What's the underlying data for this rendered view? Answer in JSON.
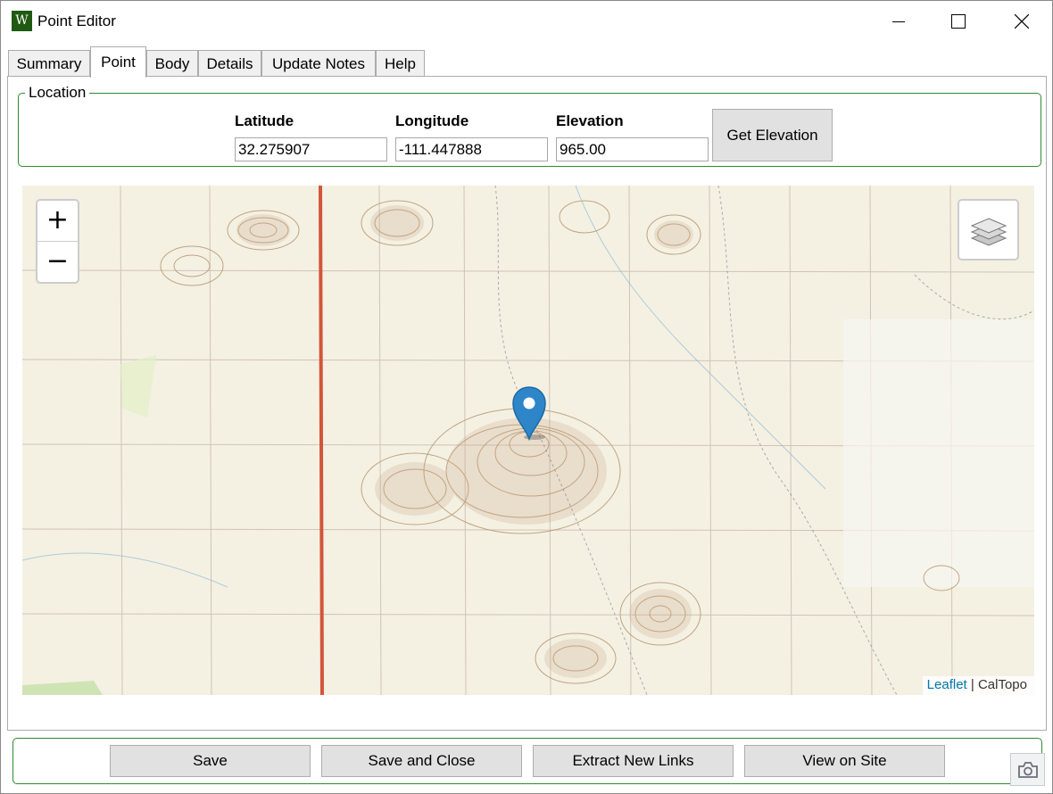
{
  "window": {
    "title": "Point Editor",
    "icon_letter": "W",
    "controls": [
      "minimize-icon",
      "maximize-icon",
      "close-icon"
    ]
  },
  "tabs": [
    {
      "label": "Summary",
      "active": false
    },
    {
      "label": "Point",
      "active": true
    },
    {
      "label": "Body",
      "active": false
    },
    {
      "label": "Details",
      "active": false
    },
    {
      "label": "Update Notes",
      "active": false
    },
    {
      "label": "Help",
      "active": false
    }
  ],
  "location": {
    "legend": "Location",
    "latitude_label": "Latitude",
    "latitude_value": "32.275907",
    "longitude_label": "Longitude",
    "longitude_value": "-111.447888",
    "elevation_label": "Elevation",
    "elevation_value": "965.00",
    "get_elevation_label": "Get Elevation"
  },
  "map": {
    "zoom_in": "+",
    "zoom_out": "−",
    "layers_icon": "layers-icon",
    "attribution_link": "Leaflet",
    "attribution_separator": " | ",
    "attribution_text": "CalTopo",
    "marker_color": "#2e86c8"
  },
  "buttons": {
    "save": "Save",
    "save_close": "Save and Close",
    "extract_links": "Extract New Links",
    "view_site": "View on Site"
  },
  "colors": {
    "accent_border": "#2e8b2e",
    "app_icon": "#1f5a12"
  }
}
